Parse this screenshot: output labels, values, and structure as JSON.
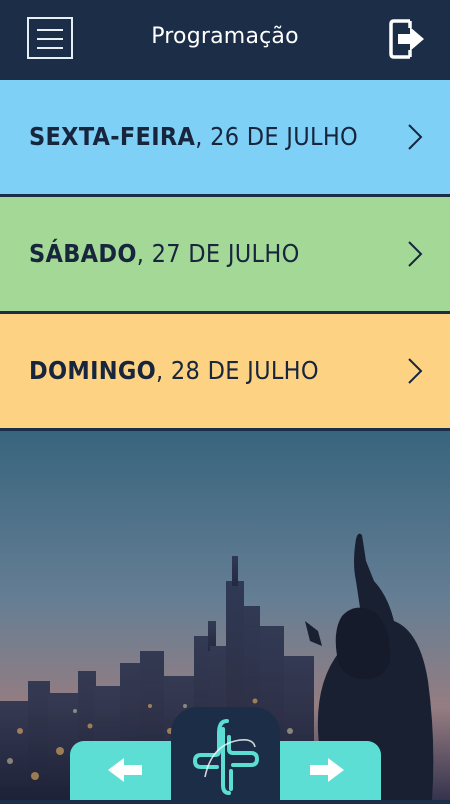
{
  "header": {
    "title": "Programação",
    "menu_icon": "hamburger-menu-icon",
    "exit_icon": "logout-icon"
  },
  "days": [
    {
      "weekday": "SEXTA-FEIRA",
      "date": ", 26 DE JULHO",
      "color": "#7fd0f7"
    },
    {
      "weekday": "SÁBADO",
      "date": ", 27 DE JULHO",
      "color": "#a3d897"
    },
    {
      "weekday": "DOMINGO",
      "date": ", 28 DE JULHO",
      "color": "#fdd383"
    }
  ],
  "bottom_nav": {
    "prev_icon": "arrow-left-icon",
    "center_icon": "cross-logo-icon",
    "next_icon": "arrow-right-icon",
    "accent": "#5dded5"
  },
  "colors": {
    "navy": "#1b2d47"
  }
}
